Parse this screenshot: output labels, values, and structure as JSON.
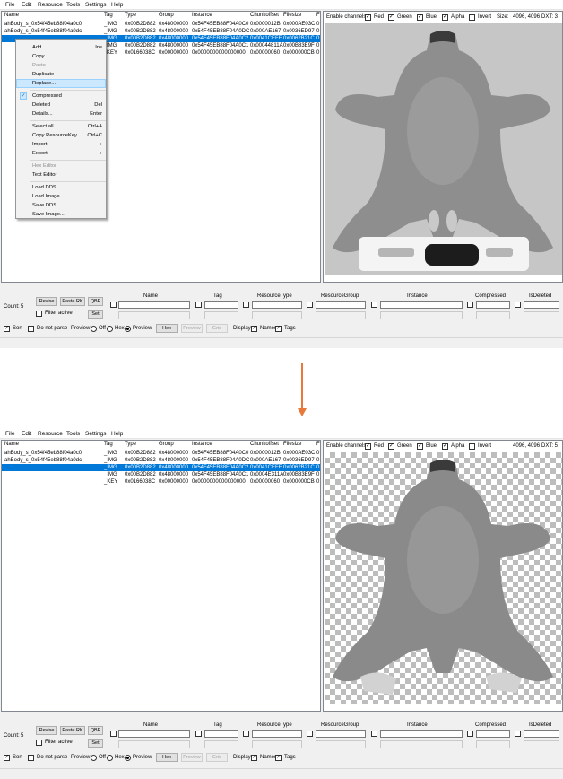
{
  "menu": [
    "File",
    "Edit",
    "Resource",
    "Tools",
    "Settings",
    "Help"
  ],
  "columns": [
    "Name",
    "Tag",
    "Type",
    "Group",
    "Instance",
    "Chunkoffset",
    "Filesize",
    "F"
  ],
  "rows": [
    {
      "name": "ahBody_s_0x54f45eb88f04a0c0",
      "tag": "",
      "type": "",
      "group": "",
      "instance": "",
      "chunk": "",
      "size": "",
      "f": ""
    },
    {
      "name": "ahBody_s_0x54f45eb88f04a0dc",
      "tag": "",
      "type": "",
      "group": "",
      "instance": "",
      "chunk": "",
      "size": "",
      "f": ""
    },
    {
      "name": "",
      "tag": "_IMG",
      "type": "0x00B2D882",
      "group": "0x48000000",
      "instance": "0x54F45EB88F04A0C2",
      "chunk": "0x0041CEFE",
      "size": "0x0062B21C",
      "f": "0"
    },
    {
      "name": "",
      "tag": "_IMG",
      "type": "0x00B2D882",
      "group": "0x48000000",
      "instance": "0x54F45EB88F04A0C1",
      "chunk": "0x0004E311A",
      "size": "0x00B83E9F",
      "f": "0"
    },
    {
      "name": "",
      "tag": "_KEY",
      "type": "0x0166038C",
      "group": "0x00000000",
      "instance": "0x0000000000000000",
      "chunk": "0x00000060",
      "size": "0x000000CB",
      "f": "0"
    }
  ],
  "rows_top": [
    {
      "tag": "_IMG",
      "type": "0x00B2D882",
      "group": "0x48000000",
      "instance": "0x54F45EB88F04A0C0",
      "chunk": "0x0000012B",
      "size": "0x000AE03C",
      "f": "0"
    },
    {
      "tag": "_IMG",
      "type": "0x00B2D882",
      "group": "0x48000000",
      "instance": "0x54F45EB88F04A0DC",
      "chunk": "0x000AE167",
      "size": "0x0036ED97",
      "f": "0"
    }
  ],
  "rows_shot1_partial": [
    {
      "tag": "IMG",
      "type": "0x00B2D882",
      "group": "0x48000000",
      "instance": "0x54F45EB88F04A0C1",
      "chunk": "0x00044811A",
      "size": "0x00B83E9F",
      "f": "0"
    },
    {
      "tag": "KEY",
      "type": "0x0166038C",
      "group": "0x00000000",
      "instance": "0x0000000000000000",
      "chunk": "0x00000060",
      "size": "0x000000CB",
      "f": "0"
    }
  ],
  "channels": {
    "label": "Enable channels:",
    "red": "Red",
    "green": "Green",
    "blue": "Blue",
    "alpha": "Alpha",
    "invert": "Invert",
    "size_label": "Size:",
    "size_value": "4096, 4096",
    "dxt_label": "DXT: 3",
    "dxt_label_2": "DXT: 5"
  },
  "filter": {
    "count_label": "Count:",
    "count_value": "5",
    "revise": "Revise",
    "paste_rk": "Paste RK",
    "qbe": "QBE",
    "filter_active": "Filter active",
    "set": "Set",
    "headers": [
      "Name",
      "Tag",
      "ResourceType",
      "ResourceGroup",
      "Instance",
      "Compressed",
      "IsDeleted"
    ],
    "sort": "Sort",
    "do_not_parse": "Do not parse",
    "preview_label": "Preview:",
    "off": "Off",
    "hex": "Hex",
    "preview": "Preview",
    "btn_hex": "Hex",
    "btn_preview": "Preview",
    "btn_grid": "Grid",
    "display_label": "Display:",
    "names": "Names",
    "tags": "Tags"
  },
  "context_menu": {
    "add": "Add...",
    "add_sc": "Ins",
    "copy": "Copy",
    "paste": "Paste...",
    "duplicate": "Duplicate",
    "replace": "Replace...",
    "compressed": "Compressed",
    "deleted": "Deleted",
    "deleted_sc": "Del",
    "details": "Details...",
    "details_sc": "Enter",
    "select_all": "Select all",
    "select_all_sc": "Ctrl+A",
    "copy_rk": "Copy ResourceKey",
    "copy_rk_sc": "Ctrl+C",
    "import": "Import",
    "export": "Export",
    "hex_editor": "Hex Editor",
    "text_editor": "Text Editor",
    "load_dds": "Load DDS...",
    "load_image": "Load Image...",
    "save_dds": "Save DDS...",
    "save_image": "Save Image..."
  },
  "colors": {
    "selection": "#0078d7",
    "arrow": "#e8793a",
    "menu_highlight": "#cce8ff"
  }
}
